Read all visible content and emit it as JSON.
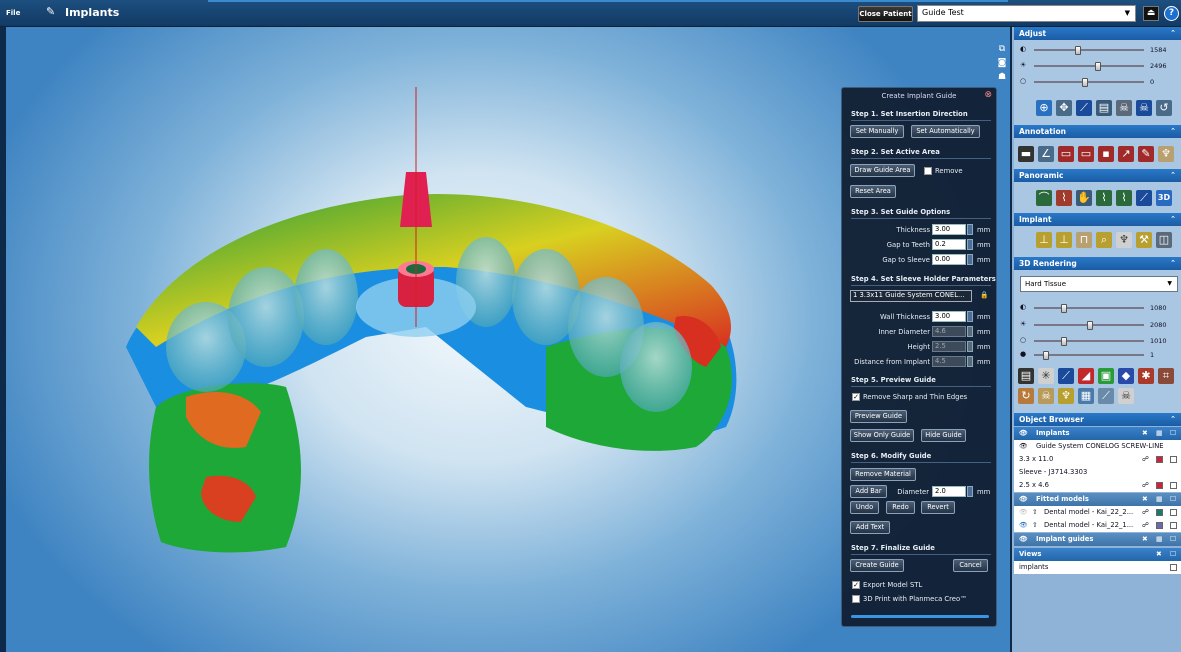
{
  "topbar": {
    "file_label": "File",
    "title": "Implants",
    "close_patient": "Close Patient",
    "guide_select": "Guide Test",
    "help_icon": "?"
  },
  "dialog": {
    "title": "Create Implant Guide",
    "step1": {
      "title": "Step 1. Set Insertion Direction",
      "set_manually": "Set Manually",
      "set_automatically": "Set Automatically"
    },
    "step2": {
      "title": "Step 2. Set Active Area",
      "draw_guide_area": "Draw Guide Area",
      "remove_label": "Remove",
      "reset_area": "Reset Area"
    },
    "step3": {
      "title": "Step 3. Set Guide Options",
      "thickness_label": "Thickness",
      "thickness_value": "3.00",
      "gap_teeth_label": "Gap to Teeth",
      "gap_teeth_value": "0.2",
      "gap_sleeve_label": "Gap to Sleeve",
      "gap_sleeve_value": "0.00",
      "unit": "mm"
    },
    "step4": {
      "title": "Step 4. Set Sleeve Holder Parameters",
      "sleeve_select": "1 3.3x11 Guide System CONEL...",
      "wall_label": "Wall Thickness",
      "wall_value": "3.00",
      "inner_label": "Inner Diameter",
      "inner_value": "4.6",
      "height_label": "Height",
      "height_value": "2.5",
      "distance_label": "Distance from Implant",
      "distance_value": "4.5",
      "unit": "mm"
    },
    "step5": {
      "title": "Step 5. Preview Guide",
      "remove_sharp": "Remove Sharp and Thin Edges",
      "preview_guide": "Preview Guide",
      "show_only_guide": "Show Only Guide",
      "hide_guide": "Hide Guide"
    },
    "step6": {
      "title": "Step 6. Modify Guide",
      "remove_material": "Remove Material",
      "add_bar": "Add Bar",
      "diameter_label": "Diameter",
      "diameter_value": "2.0",
      "unit": "mm",
      "undo": "Undo",
      "redo": "Redo",
      "revert": "Revert",
      "add_text": "Add Text"
    },
    "step7": {
      "title": "Step 7. Finalize Guide",
      "create_guide": "Create Guide",
      "cancel": "Cancel",
      "export_stl": "Export Model STL",
      "print_creo": "3D Print with Planmeca Creo™"
    }
  },
  "panel": {
    "adjust": {
      "title": "Adjust",
      "values": [
        "1584",
        "2496",
        "0"
      ],
      "levels": [
        0.38,
        0.58,
        0.45
      ]
    },
    "annotation": {
      "title": "Annotation"
    },
    "panoramic": {
      "title": "Panoramic",
      "label_3d": "3D"
    },
    "implant": {
      "title": "Implant"
    },
    "rendering": {
      "title": "3D Rendering",
      "preset": "Hard Tissue",
      "values": [
        "1080",
        "2080",
        "1010",
        "1"
      ],
      "levels": [
        0.25,
        0.5,
        0.25,
        0.08
      ]
    },
    "object_browser": {
      "title": "Object Browser",
      "implants_header": "Implants",
      "implant_name": "Guide System CONELOG SCREW-LINE Pro...",
      "implant_size": "3.3 x 11.0",
      "sleeve_name": "Sleeve - J3714.3303",
      "sleeve_size": "2.5 x 4.6",
      "fitted_header": "Fitted models",
      "model1": "Dental model - Kai_22_2...",
      "model2": "Dental model - Kai_22_1...",
      "guides_header": "Implant guides"
    },
    "views": {
      "title": "Views",
      "item": "implants"
    }
  },
  "colors": {
    "accent": "#2a79c9",
    "implant_red": "#d0203a",
    "model_teal": "#1a7a6a",
    "model_purple": "#6a6aaa"
  }
}
